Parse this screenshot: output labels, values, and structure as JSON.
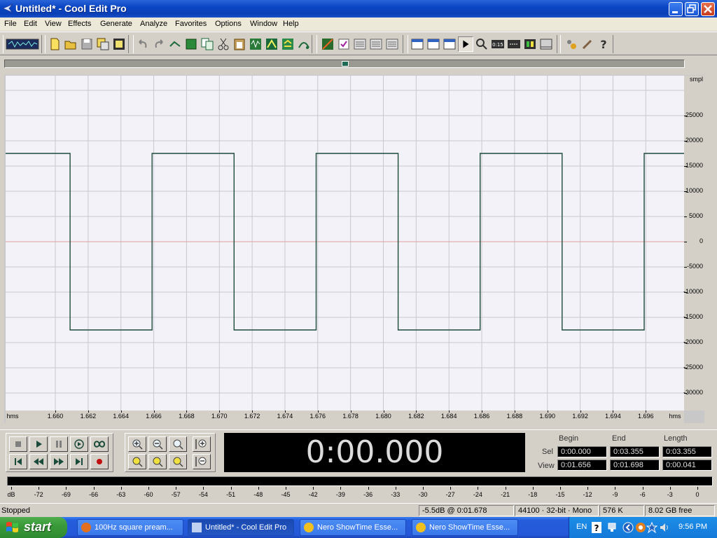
{
  "window": {
    "title": "Untitled* - Cool Edit Pro"
  },
  "menu": [
    "File",
    "Edit",
    "View",
    "Effects",
    "Generate",
    "Analyze",
    "Favorites",
    "Options",
    "Window",
    "Help"
  ],
  "toolbar": {
    "icons": [
      "waveform-multitrack-toggle-icon",
      "new-file-icon",
      "open-file-icon",
      "save-file-icon",
      "save-all-icon",
      "close-file-icon",
      "undo-icon",
      "redo-icon",
      "trim-icon",
      "crop-icon",
      "copy-icon",
      "cut-icon",
      "paste-icon",
      "mix-paste-icon",
      "insert-icon",
      "loop-icon",
      "envelope-icon",
      "marker-icon",
      "cue-list-icon",
      "playlist-icon",
      "settings-icon",
      "view-wave-icon",
      "view-spectral-icon",
      "zoom-tool-icon",
      "time-format-icon",
      "sample-format-icon",
      "meter-icon",
      "grid-icon",
      "scripts-icon",
      "cd-icon",
      "help-icon"
    ]
  },
  "wave": {
    "y_unit": "smpl",
    "y_labels": [
      "25000",
      "20000",
      "15000",
      "10000",
      "5000",
      "0",
      "-5000",
      "-10000",
      "-15000",
      "-20000",
      "-25000",
      "-30000"
    ],
    "x_unit_left": "hms",
    "x_unit_right": "hms",
    "x_labels": [
      "1.660",
      "1.662",
      "1.664",
      "1.666",
      "1.668",
      "1.670",
      "1.672",
      "1.674",
      "1.676",
      "1.678",
      "1.680",
      "1.682",
      "1.684",
      "1.686",
      "1.688",
      "1.690",
      "1.692",
      "1.694",
      "1.696"
    ],
    "waveform_color": "#1e4a3a",
    "grid_color": "#c8c8d0",
    "zero_line_color": "#e0a0a0"
  },
  "transport": {
    "buttons": [
      "stop-icon",
      "play-icon",
      "pause-icon",
      "play-to-end-icon",
      "loop-play-icon",
      "go-to-start-icon",
      "rewind-icon",
      "fast-forward-icon",
      "go-to-end-icon",
      "record-icon"
    ],
    "zoom_buttons": [
      "zoom-in-horizontal-icon",
      "zoom-out-horizontal-icon",
      "zoom-full-icon",
      "zoom-in-left-icon",
      "zoom-in-right-icon",
      "zoom-selection-icon",
      "zoom-in-vertical-icon",
      "zoom-out-vertical-icon"
    ],
    "time": "0:00.000"
  },
  "selection": {
    "headers": [
      "Begin",
      "End",
      "Length"
    ],
    "sel_label": "Sel",
    "view_label": "View",
    "sel": [
      "0:00.000",
      "0:03.355",
      "0:03.355"
    ],
    "view": [
      "0:01.656",
      "0:01.698",
      "0:00.041"
    ]
  },
  "meter": {
    "labels": [
      "dB",
      "-72",
      "-69",
      "-66",
      "-63",
      "-60",
      "-57",
      "-54",
      "-51",
      "-48",
      "-45",
      "-42",
      "-39",
      "-36",
      "-33",
      "-30",
      "-27",
      "-24",
      "-21",
      "-18",
      "-15",
      "-12",
      "-9",
      "-6",
      "-3",
      "0"
    ]
  },
  "status": {
    "state": "Stopped",
    "cursor": "-5.5dB @   0:01.678",
    "format": "44100 · 32-bit · Mono",
    "size": "576 K",
    "free": "8.02 GB free"
  },
  "taskbar": {
    "start": "start",
    "tasks": [
      {
        "label": "100Hz square pream...",
        "icon": "firefox-icon"
      },
      {
        "label": "Untitled* - Cool Edit Pro",
        "icon": "cool-edit-icon"
      },
      {
        "label": "Nero ShowTime Esse...",
        "icon": "nero-icon"
      },
      {
        "label": "Nero ShowTime Esse...",
        "icon": "nero-icon"
      }
    ],
    "lang": "EN",
    "clock": "9:56 PM"
  }
}
